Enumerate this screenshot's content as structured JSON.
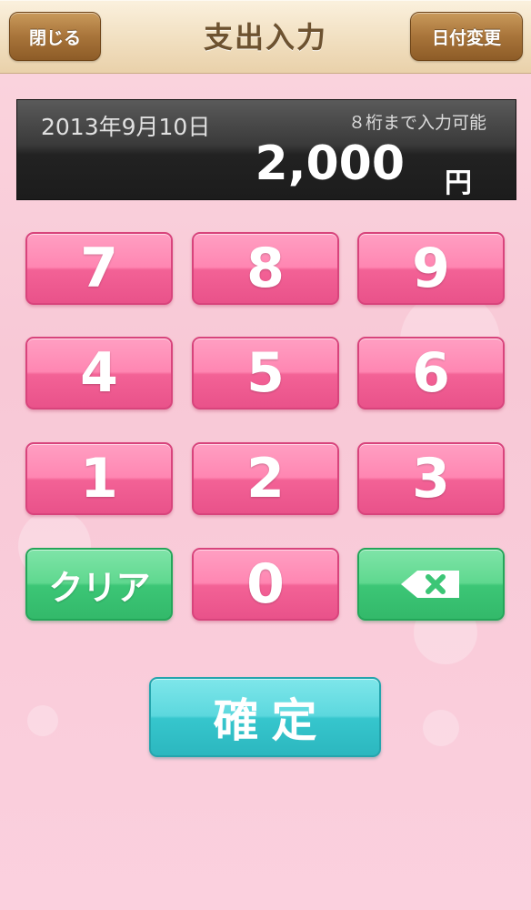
{
  "header": {
    "title": "支出入力",
    "close_label": "閉じる",
    "date_change_label": "日付変更"
  },
  "display": {
    "date": "2013年9月10日",
    "limit_note": "８桁まで入力可能",
    "amount": "2,000",
    "unit": "円"
  },
  "keypad": {
    "k7": "7",
    "k8": "8",
    "k9": "9",
    "k4": "4",
    "k5": "5",
    "k6": "6",
    "k1": "1",
    "k2": "2",
    "k3": "3",
    "clear": "クリア",
    "k0": "0",
    "backspace_icon": "backspace-icon"
  },
  "confirm_label": "確定",
  "colors": {
    "pink_key": "#f36296",
    "green_key": "#3cc676",
    "confirm": "#36c6cd",
    "header_button": "#a8743a"
  }
}
